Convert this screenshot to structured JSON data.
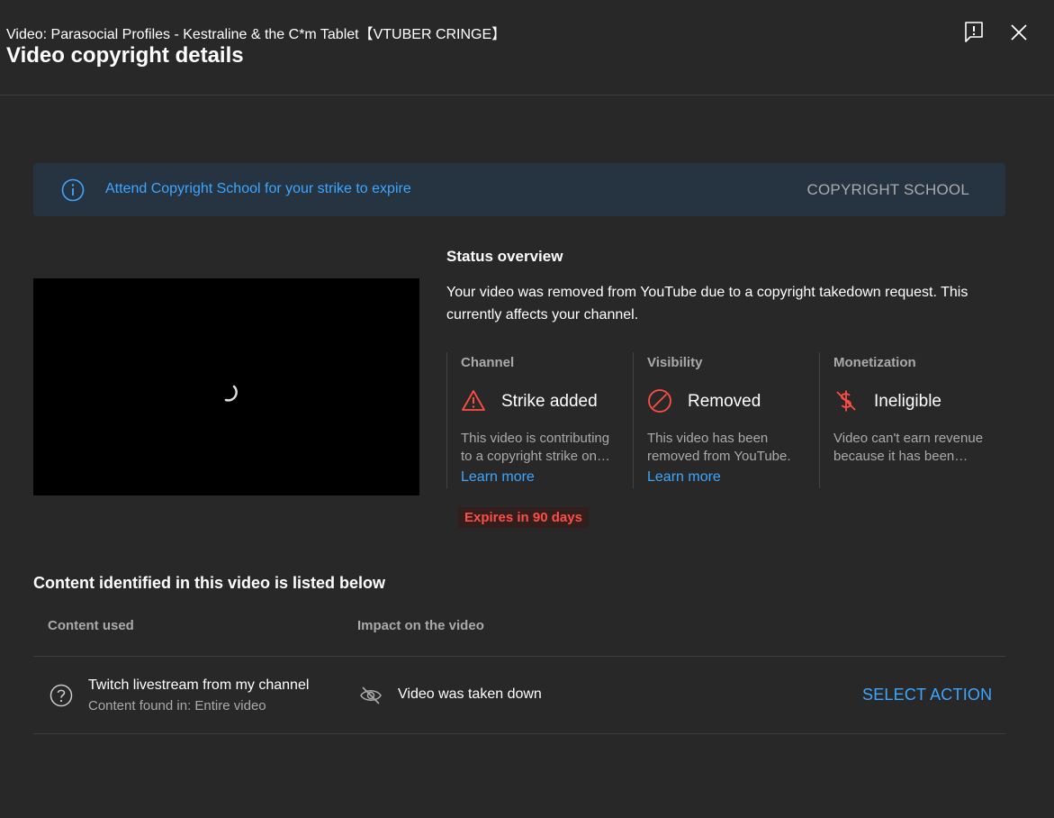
{
  "header": {
    "video_title": "Video: Parasocial Profiles - Kestraline & the C*m Tablet【VTUBER CRINGE】",
    "dialog_title": "Video copyright details",
    "feedback_icon": "feedback-flag-icon",
    "close_icon": "close-icon"
  },
  "banner": {
    "icon": "info-icon",
    "text": "Attend Copyright School for your strike to expire",
    "action_label": "COPYRIGHT SCHOOL"
  },
  "player": {
    "loading_icon": "spinner-icon"
  },
  "status": {
    "heading": "Status overview",
    "description": "Your video was removed from YouTube due to a copyright takedown request. This currently affects your channel.",
    "columns": [
      {
        "label": "Channel",
        "icon": "warning-triangle-icon",
        "value": "Strike added",
        "desc_line1": "This video is contributing",
        "desc_line2": "to a copyright strike on…",
        "link": "Learn more"
      },
      {
        "label": "Visibility",
        "icon": "blocked-circle-icon",
        "value": "Removed",
        "desc_line1": "This video has been",
        "desc_line2": "removed from YouTube.",
        "link": "Learn more"
      },
      {
        "label": "Monetization",
        "icon": "dollar-off-icon",
        "value": "Ineligible",
        "desc_line1": "Video can't earn revenue",
        "desc_line2": "because it has been…"
      }
    ],
    "expires": "Expires in 90 days",
    "colors": {
      "error": "#ff4e45",
      "link": "#3ea6ff"
    }
  },
  "content": {
    "heading": "Content identified in this video is listed below",
    "columns": [
      "Content used",
      "Impact on the video"
    ],
    "rows": [
      {
        "icon": "question-circle-icon",
        "title": "Twitch livestream from my channel",
        "subtitle": "Content found in: Entire video",
        "impact_icon": "eye-off-icon",
        "impact": "Video was taken down",
        "action": "SELECT ACTION"
      }
    ]
  }
}
